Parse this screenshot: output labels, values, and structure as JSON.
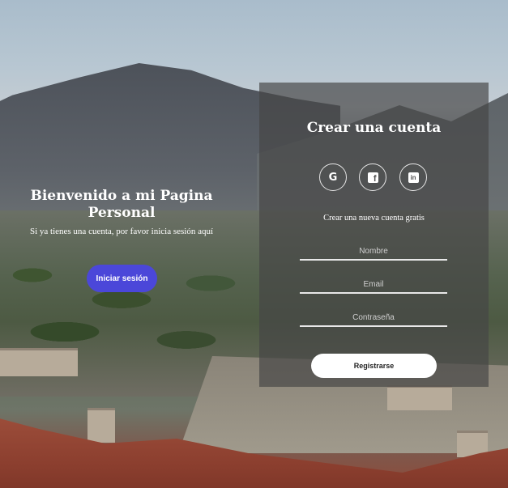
{
  "welcome": {
    "title": "Bienvenido a mi Pagina Personal",
    "subtitle": "Si ya tienes una cuenta, por favor inicia sesión aquí",
    "login_button": "Iniciar sesión"
  },
  "register": {
    "title": "Crear una cuenta",
    "social": [
      {
        "icon": "google-icon"
      },
      {
        "icon": "facebook-icon"
      },
      {
        "icon": "linkedin-icon"
      }
    ],
    "subtitle": "Crear una nueva cuenta gratis",
    "fields": {
      "name_placeholder": "Nombre",
      "email_placeholder": "Email",
      "password_placeholder": "Contraseña"
    },
    "submit_button": "Registrarse"
  },
  "colors": {
    "primary": "#4b47d9",
    "panel": "#464646"
  }
}
